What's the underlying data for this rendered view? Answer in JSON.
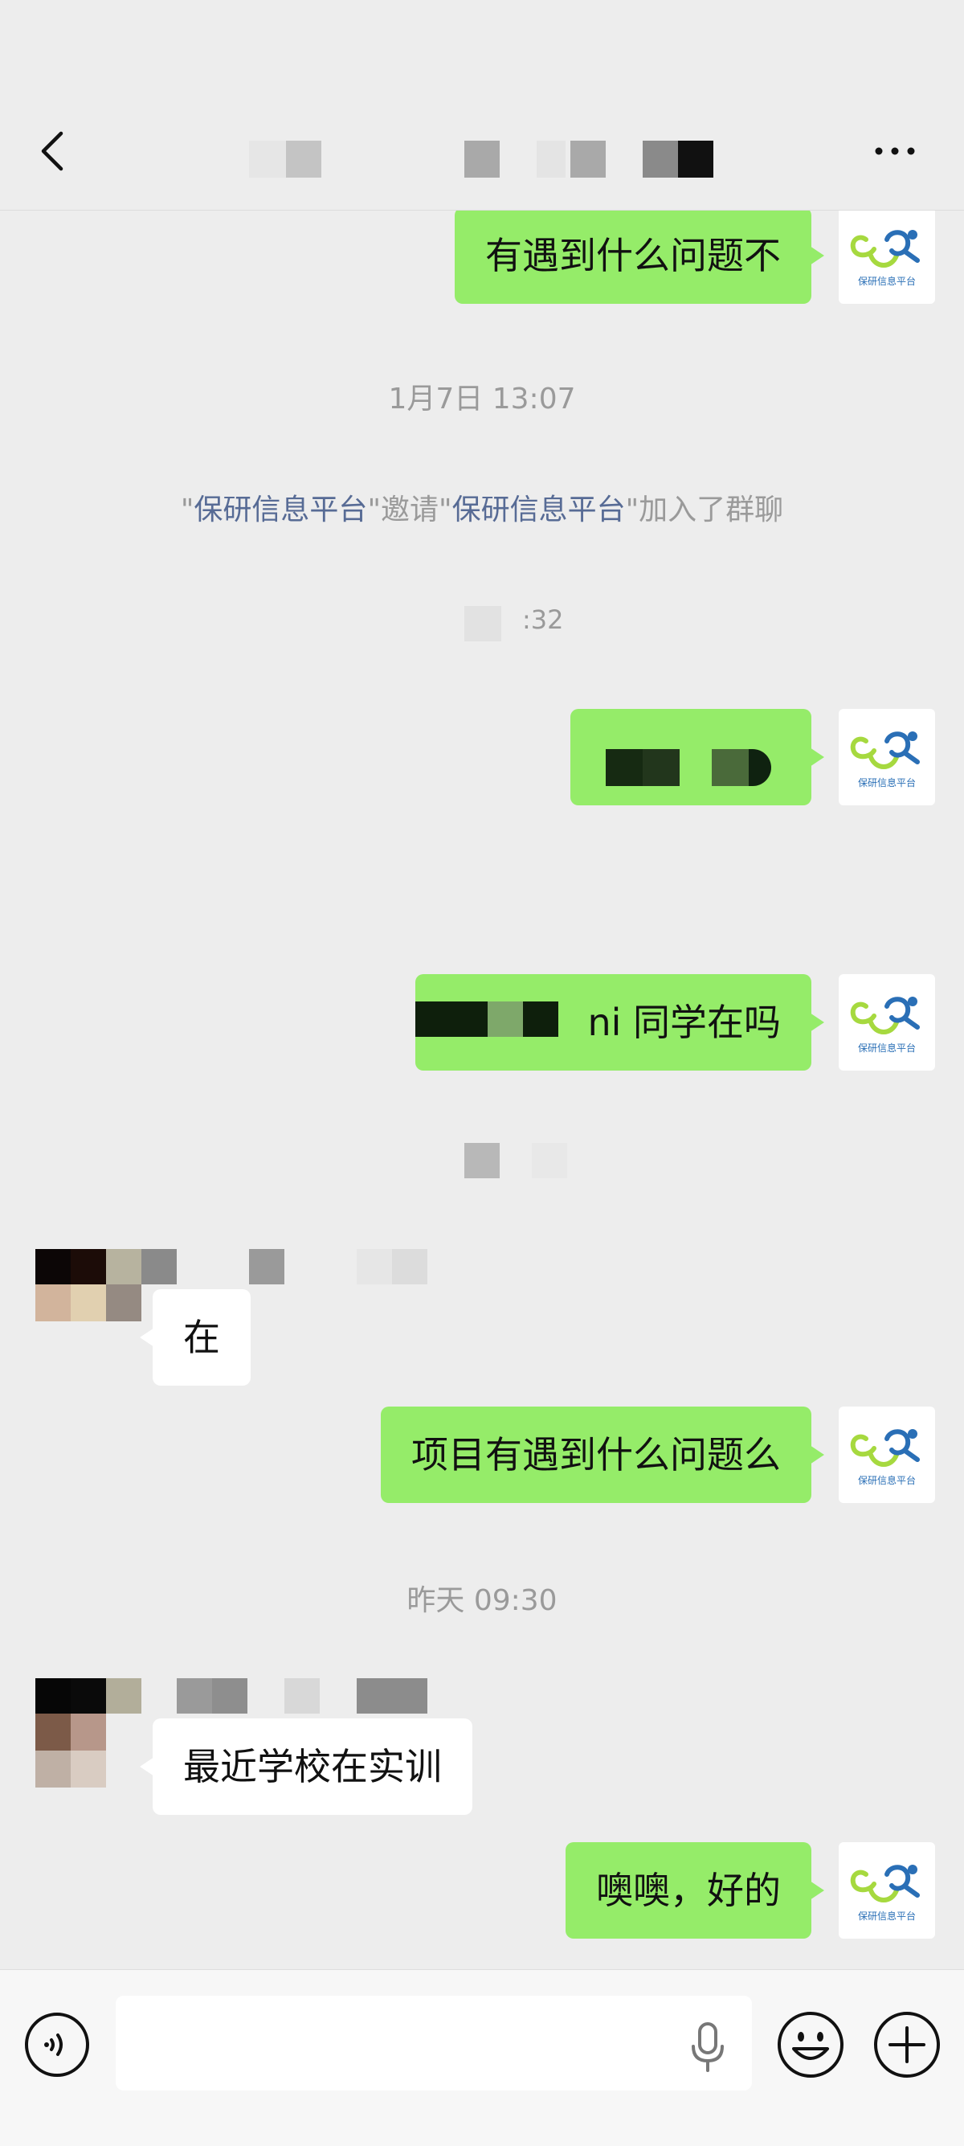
{
  "header": {
    "back_icon": "chevron-left-icon",
    "more_icon": "more-horizontal-icon"
  },
  "messages": {
    "m1": "有遇到什么问题不",
    "m2_suffix": "ni  同学在吗",
    "m3": "在",
    "m4": "项目有遇到什么问题么",
    "m5": "最近学校在实训",
    "m6": "噢噢，好的"
  },
  "system": {
    "time1": "1月7日 13:07",
    "invite_q1": "\"",
    "invite_name1": "保研信息平台",
    "invite_q2": "\"邀请\"",
    "invite_name2": "保研信息平台",
    "invite_tail": "\"加入了群聊",
    "partial_time": ":32",
    "time2": "昨天 09:30"
  },
  "avatar": {
    "logo_text": "保研信息平台"
  },
  "colors": {
    "self_bubble": "#95ec69",
    "link_blue": "#576b95",
    "logo_green": "#a6d93f",
    "logo_blue": "#2a6fb6"
  },
  "inputbar": {
    "voice_icon": "voice-icon",
    "mic_icon": "microphone-icon",
    "emoji_icon": "emoji-icon",
    "plus_icon": "plus-circle-icon"
  }
}
